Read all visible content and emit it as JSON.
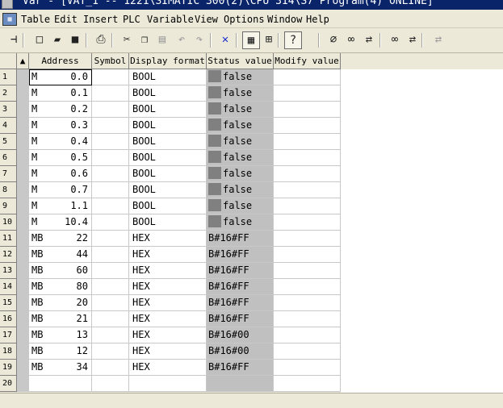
{
  "window": {
    "title": "Var - [VAT_1 -- 1221\\SIMATIC 300(2)\\CPU 314\\S7 Program(4)  ONLINE]"
  },
  "menu": {
    "items": [
      "Table",
      "Edit",
      "Insert",
      "PLC",
      "Variable",
      "View",
      "Options",
      "Window",
      "Help"
    ]
  },
  "toolbar": {
    "buttons": [
      {
        "name": "pin-icon",
        "glyph": "⊣",
        "state": "normal"
      },
      {
        "name": "new-icon",
        "glyph": "□",
        "state": "normal"
      },
      {
        "name": "open-icon",
        "glyph": "▰",
        "state": "normal"
      },
      {
        "name": "save-icon",
        "glyph": "■",
        "state": "normal"
      },
      {
        "name": "print-icon",
        "glyph": "⎙",
        "state": "normal"
      },
      {
        "name": "cut-icon",
        "glyph": "✂",
        "state": "normal"
      },
      {
        "name": "copy-icon",
        "glyph": "❐",
        "state": "normal"
      },
      {
        "name": "paste-icon",
        "glyph": "▤",
        "state": "disabled"
      },
      {
        "name": "undo-icon",
        "glyph": "↶",
        "state": "disabled"
      },
      {
        "name": "redo-icon",
        "glyph": "↷",
        "state": "disabled"
      },
      {
        "name": "disconnect-icon",
        "glyph": "✕",
        "state": "normal"
      },
      {
        "name": "online-icon",
        "glyph": "▦",
        "state": "selected"
      },
      {
        "name": "accessible-nodes-icon",
        "glyph": "⊞",
        "state": "normal"
      },
      {
        "name": "help-pointer-icon",
        "glyph": "?",
        "state": "selected"
      },
      {
        "name": "monitor-icon",
        "glyph": "⌀",
        "state": "normal"
      },
      {
        "name": "monitor-once-icon",
        "glyph": "∞",
        "state": "normal"
      },
      {
        "name": "modify-icon",
        "glyph": "⇄",
        "state": "normal"
      },
      {
        "name": "update-icon",
        "glyph": "∞",
        "state": "normal"
      },
      {
        "name": "activate-icon",
        "glyph": "⇄",
        "state": "normal"
      },
      {
        "name": "force-icon",
        "glyph": "⇄",
        "state": "disabled"
      }
    ]
  },
  "table": {
    "columns": {
      "address": "Address",
      "symbol": "Symbol",
      "display_format": "Display format",
      "status_value": "Status value",
      "modify_value": "Modify value"
    },
    "rows": [
      {
        "n": "1",
        "op": "M",
        "num": "0.0",
        "fmt": "BOOL",
        "status": "false",
        "swatch": true
      },
      {
        "n": "2",
        "op": "M",
        "num": "0.1",
        "fmt": "BOOL",
        "status": "false",
        "swatch": true
      },
      {
        "n": "3",
        "op": "M",
        "num": "0.2",
        "fmt": "BOOL",
        "status": "false",
        "swatch": true
      },
      {
        "n": "4",
        "op": "M",
        "num": "0.3",
        "fmt": "BOOL",
        "status": "false",
        "swatch": true
      },
      {
        "n": "5",
        "op": "M",
        "num": "0.4",
        "fmt": "BOOL",
        "status": "false",
        "swatch": true
      },
      {
        "n": "6",
        "op": "M",
        "num": "0.5",
        "fmt": "BOOL",
        "status": "false",
        "swatch": true
      },
      {
        "n": "7",
        "op": "M",
        "num": "0.6",
        "fmt": "BOOL",
        "status": "false",
        "swatch": true
      },
      {
        "n": "8",
        "op": "M",
        "num": "0.7",
        "fmt": "BOOL",
        "status": "false",
        "swatch": true
      },
      {
        "n": "9",
        "op": "M",
        "num": "1.1",
        "fmt": "BOOL",
        "status": "false",
        "swatch": true
      },
      {
        "n": "10",
        "op": "M",
        "num": "10.4",
        "fmt": "BOOL",
        "status": "false",
        "swatch": true
      },
      {
        "n": "11",
        "op": "MB",
        "num": "22",
        "fmt": "HEX",
        "status": "B#16#FF",
        "swatch": false
      },
      {
        "n": "12",
        "op": "MB",
        "num": "44",
        "fmt": "HEX",
        "status": "B#16#FF",
        "swatch": false
      },
      {
        "n": "13",
        "op": "MB",
        "num": "60",
        "fmt": "HEX",
        "status": "B#16#FF",
        "swatch": false
      },
      {
        "n": "14",
        "op": "MB",
        "num": "80",
        "fmt": "HEX",
        "status": "B#16#FF",
        "swatch": false
      },
      {
        "n": "15",
        "op": "MB",
        "num": "20",
        "fmt": "HEX",
        "status": "B#16#FF",
        "swatch": false
      },
      {
        "n": "16",
        "op": "MB",
        "num": "21",
        "fmt": "HEX",
        "status": "B#16#FF",
        "swatch": false
      },
      {
        "n": "17",
        "op": "MB",
        "num": "13",
        "fmt": "HEX",
        "status": "B#16#00",
        "swatch": false
      },
      {
        "n": "18",
        "op": "MB",
        "num": "12",
        "fmt": "HEX",
        "status": "B#16#00",
        "swatch": false
      },
      {
        "n": "19",
        "op": "MB",
        "num": "34",
        "fmt": "HEX",
        "status": "B#16#FF",
        "swatch": false
      },
      {
        "n": "20",
        "op": "",
        "num": "",
        "fmt": "",
        "status": "",
        "swatch": false
      }
    ]
  }
}
